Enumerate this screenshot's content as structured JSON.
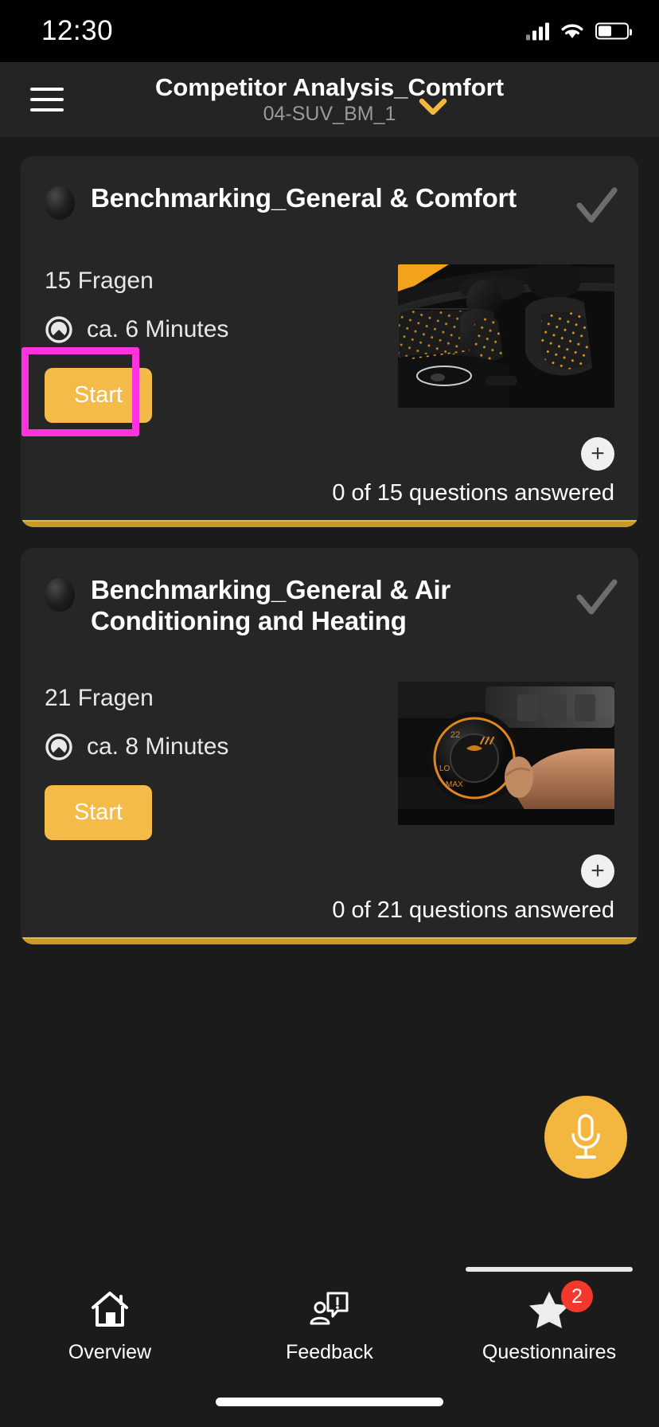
{
  "status_bar": {
    "time": "12:30",
    "signal_icon": "cellular-signal-icon",
    "wifi_icon": "wifi-icon",
    "battery_icon": "battery-icon"
  },
  "header": {
    "menu_icon": "hamburger-menu-icon",
    "title": "Competitor Analysis_Comfort",
    "subtitle": "04-SUV_BM_1",
    "dropdown_icon": "chevron-down-icon",
    "accent_color": "#f3b63f"
  },
  "cards": [
    {
      "status_icon": "status-dot-icon",
      "title": "Benchmarking_General & Comfort",
      "check_icon": "checkmark-icon",
      "questions_label": "15 Fragen",
      "duration_icon": "clock-icon",
      "duration_label": "ca. 6 Minutes",
      "start_label": "Start",
      "add_icon": "plus-icon",
      "answered_label": "0 of 15 questions answered",
      "thumbnail_alt": "car-interior-seats-photo",
      "highlighted": true,
      "highlight_color": "#ff33dd",
      "accent_color": "#c89a2a"
    },
    {
      "status_icon": "status-dot-icon",
      "title": "Benchmarking_General & Air Conditioning and Heating",
      "check_icon": "checkmark-icon",
      "questions_label": "21 Fragen",
      "duration_icon": "clock-icon",
      "duration_label": "ca. 8 Minutes",
      "start_label": "Start",
      "add_icon": "plus-icon",
      "answered_label": "0 of 21 questions answered",
      "thumbnail_alt": "climate-control-dial-photo",
      "highlighted": false,
      "accent_color": "#c89a2a"
    }
  ],
  "fab": {
    "icon": "microphone-icon",
    "color": "#f3b63f"
  },
  "tabbar": {
    "items": [
      {
        "icon": "home-icon",
        "label": "Overview",
        "active": false,
        "badge": ""
      },
      {
        "icon": "feedback-person-icon",
        "label": "Feedback",
        "active": false,
        "badge": ""
      },
      {
        "icon": "star-icon",
        "label": "Questionnaires",
        "active": true,
        "badge": "2"
      }
    ],
    "badge_color": "#f4392c"
  }
}
